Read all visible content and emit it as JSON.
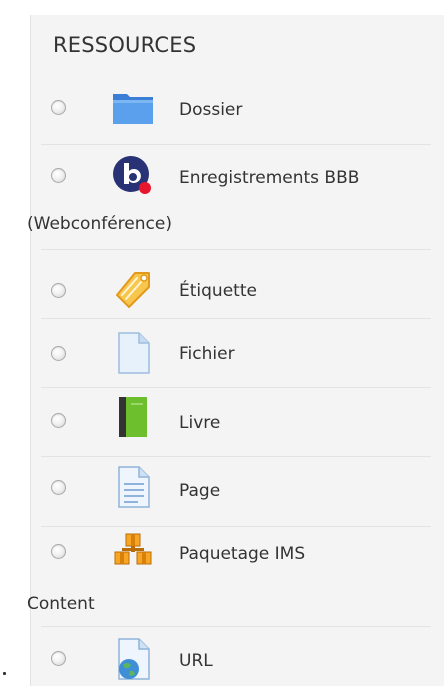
{
  "section": {
    "title": "RESSOURCES"
  },
  "items": [
    {
      "label": "Dossier",
      "icon": "folder-icon"
    },
    {
      "label": "Enregistrements BBB",
      "sublabel": "(Webconférence)",
      "icon": "bigbluebutton-icon"
    },
    {
      "label": "Étiquette",
      "icon": "label-tag-icon"
    },
    {
      "label": "Fichier",
      "icon": "file-icon"
    },
    {
      "label": "Livre",
      "icon": "book-icon"
    },
    {
      "label": "Page",
      "icon": "page-icon"
    },
    {
      "label": "Paquetage IMS",
      "sublabel": "Content",
      "icon": "ims-package-icon"
    },
    {
      "label": "URL",
      "icon": "url-globe-icon"
    }
  ],
  "colors": {
    "panel_bg": "#f4f4f4",
    "folder": "#4a90e2",
    "bbb_dark": "#283274",
    "bbb_dot": "#e8162c",
    "tag": "#f5a623",
    "book_green": "#6dbf2e",
    "ims_orange": "#f6a623"
  }
}
